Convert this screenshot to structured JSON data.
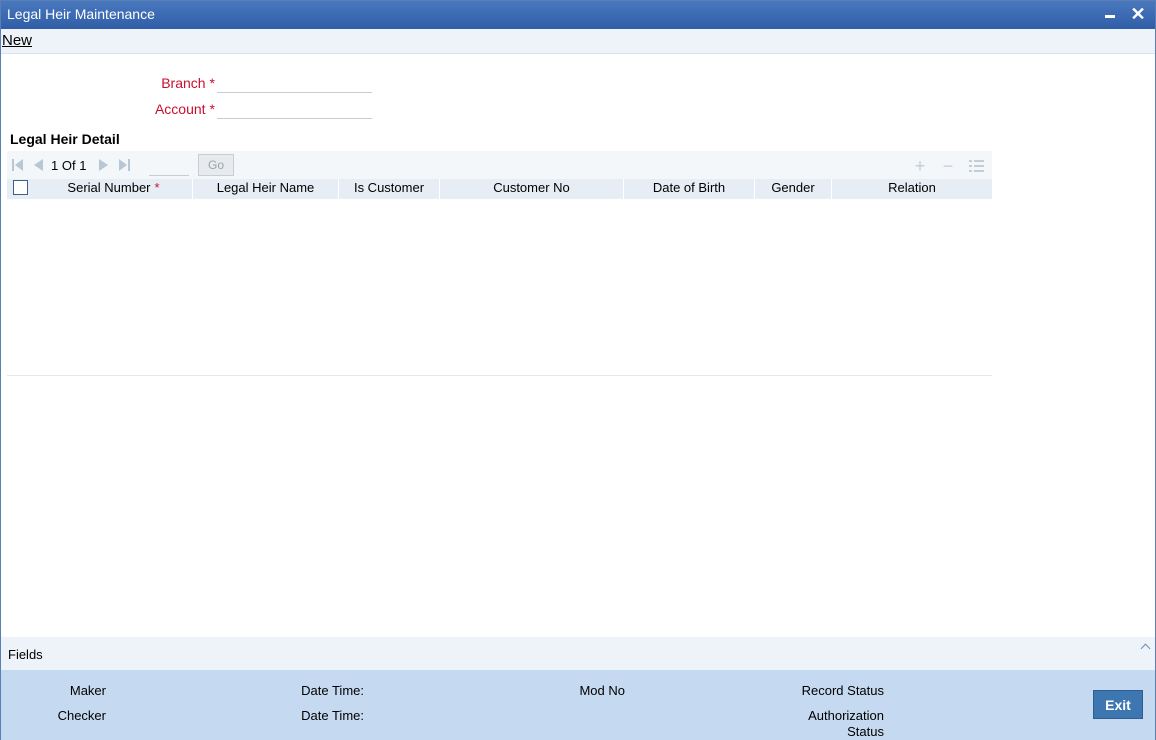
{
  "window": {
    "title": "Legal Heir Maintenance",
    "minimize_icon": "minimize-icon",
    "close_icon": "close-icon",
    "close_glyph": "✕"
  },
  "menu": {
    "new_label": "New"
  },
  "form": {
    "branch": {
      "label": "Branch",
      "required_mark": "*",
      "value": ""
    },
    "account": {
      "label": "Account",
      "required_mark": "*",
      "value": ""
    }
  },
  "legal_heir_detail": {
    "title": "Legal Heir Detail",
    "pagination": {
      "current": "1",
      "of_label": "Of",
      "total": "1",
      "go_label": "Go"
    },
    "toolbar_icons": [
      "add-row-icon",
      "remove-row-icon",
      "single-view-icon"
    ],
    "add_glyph": "+",
    "remove_glyph": "−",
    "columns": [
      {
        "label": "Serial Number",
        "required_mark": "*"
      },
      {
        "label": "Legal Heir Name"
      },
      {
        "label": "Is Customer"
      },
      {
        "label": "Customer No"
      },
      {
        "label": "Date of Birth"
      },
      {
        "label": "Gender"
      },
      {
        "label": "Relation"
      }
    ],
    "rows": []
  },
  "fields_bar": {
    "label": "Fields"
  },
  "audit": {
    "maker": "Maker",
    "maker_date_time": "Date Time:",
    "mod_no": "Mod No",
    "record_status": "Record Status",
    "checker": "Checker",
    "checker_date_time": "Date Time:",
    "authorization_status_line1": "Authorization",
    "authorization_status_line2": "Status",
    "exit_label": "Exit"
  },
  "colors": {
    "titlebar": "#2f5ea7",
    "required_label": "#c8102e",
    "audit_bg": "#c5daf0",
    "exit_button": "#3d76b1"
  }
}
